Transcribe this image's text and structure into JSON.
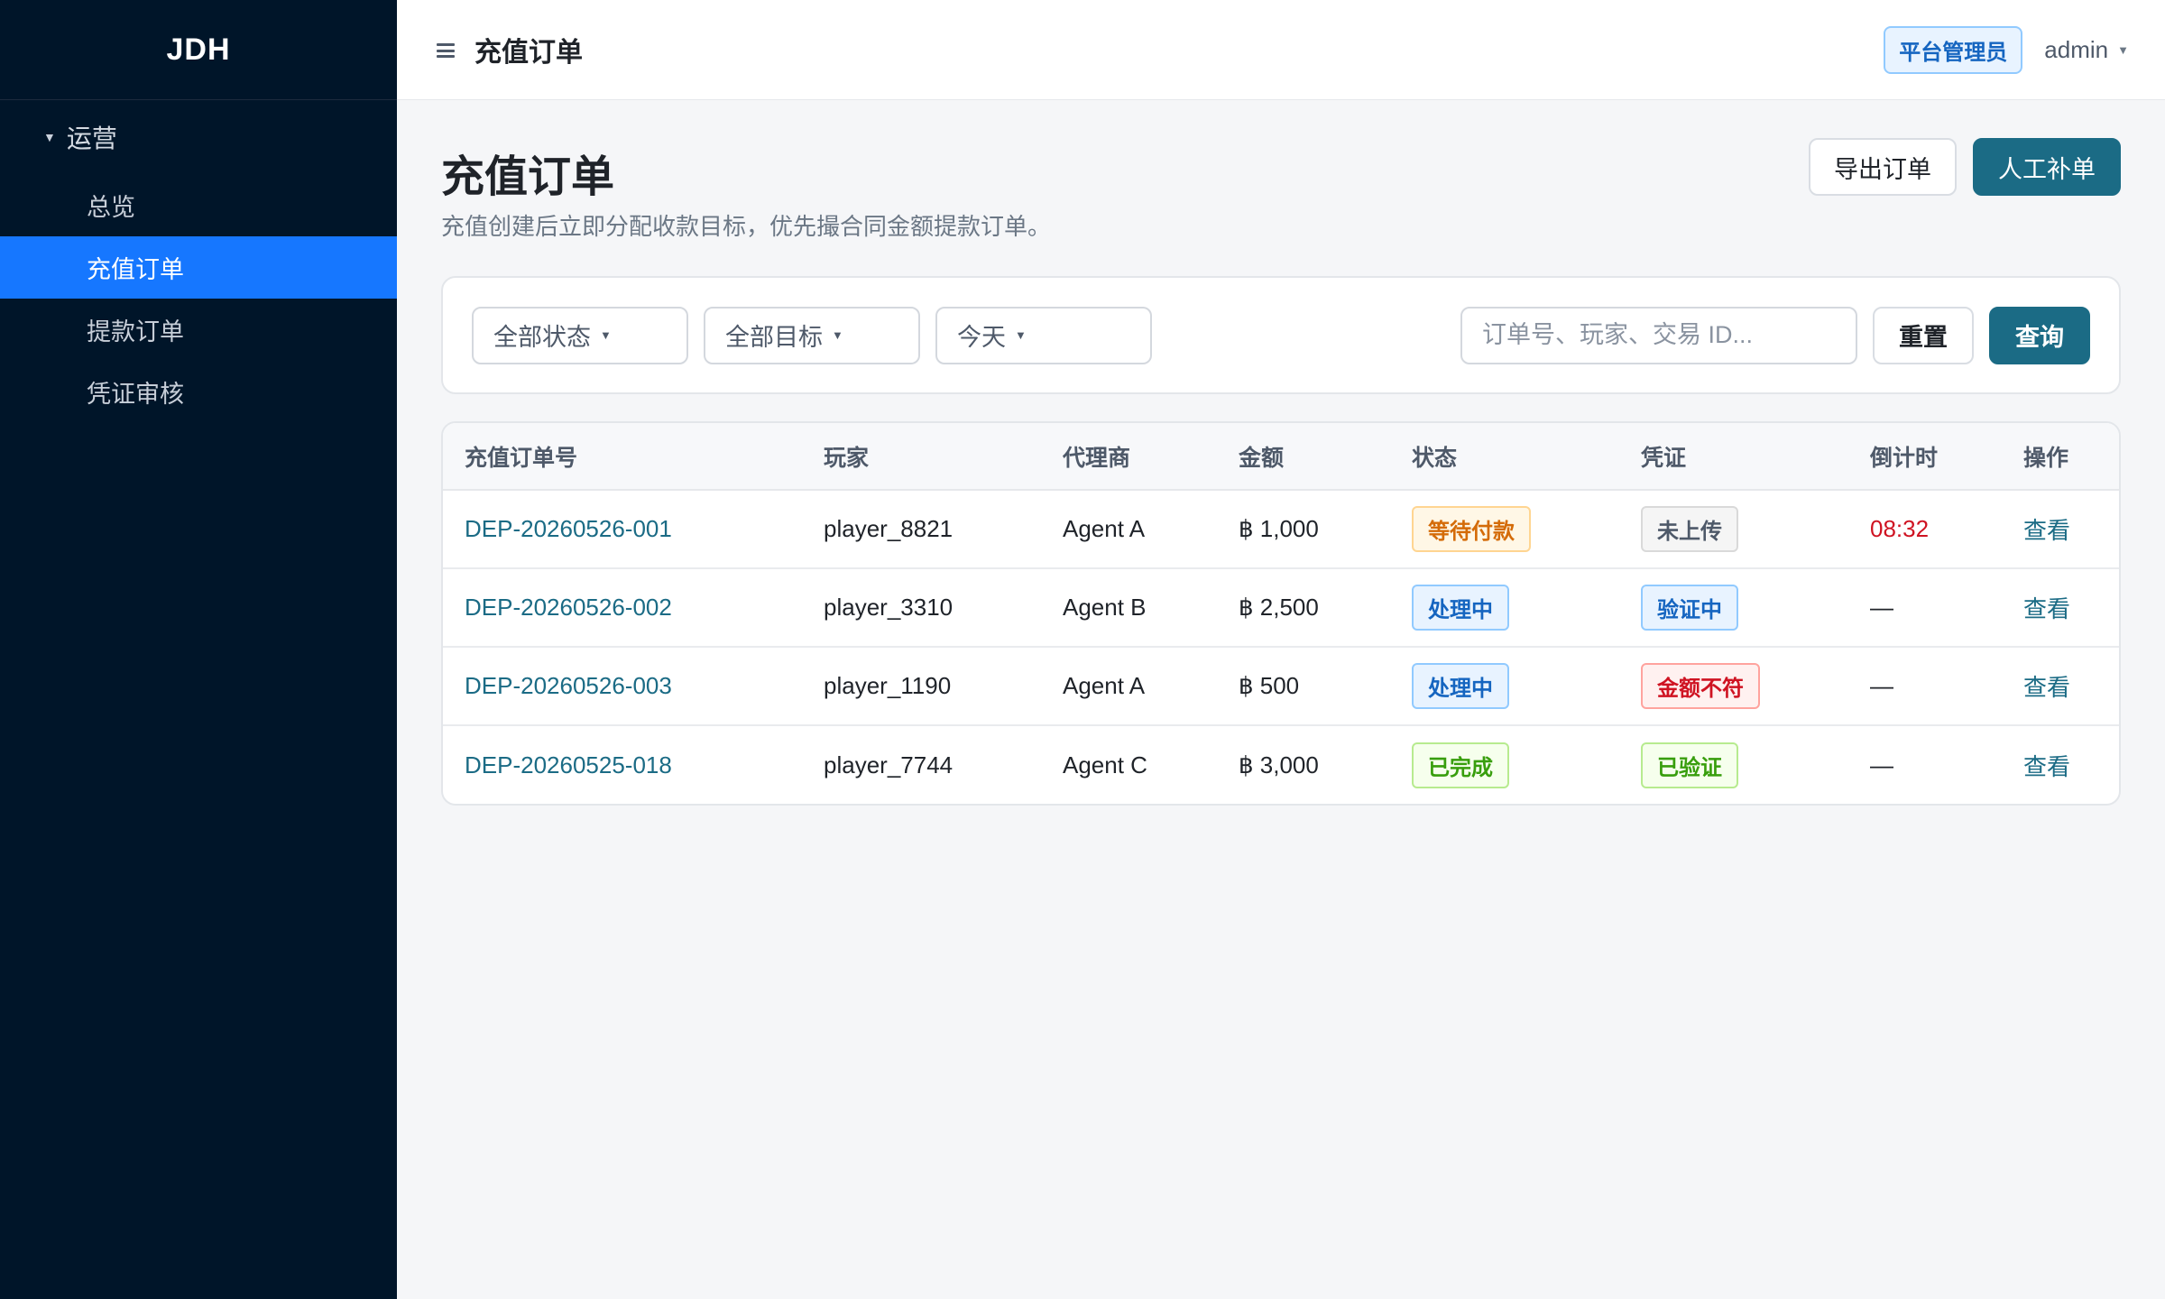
{
  "app": {
    "brand": "JDH"
  },
  "header": {
    "title": "充值订单",
    "role_badge": "平台管理员",
    "user": "admin"
  },
  "sidebar": {
    "group_label": "运营",
    "items": [
      {
        "label": "总览",
        "active": false
      },
      {
        "label": "充值订单",
        "active": true
      },
      {
        "label": "提款订单",
        "active": false
      },
      {
        "label": "凭证审核",
        "active": false
      }
    ]
  },
  "page": {
    "title": "充值订单",
    "description": "充值创建后立即分配收款目标，优先撮合同金额提款订单。",
    "export_label": "导出订单",
    "manual_label": "人工补单"
  },
  "filters": {
    "status": "全部状态",
    "target": "全部目标",
    "date": "今天",
    "search_placeholder": "订单号、玩家、交易 ID...",
    "reset_label": "重置",
    "query_label": "查询"
  },
  "table": {
    "columns": [
      "充值订单号",
      "玩家",
      "代理商",
      "金额",
      "状态",
      "凭证",
      "倒计时",
      "操作"
    ],
    "rows": [
      {
        "order_id": "DEP-20260526-001",
        "player": "player_8821",
        "agent": "Agent A",
        "amount": "฿ 1,000",
        "status": "等待付款",
        "status_color": "orange",
        "proof": "未上传",
        "proof_color": "gray",
        "countdown": "08:32",
        "action": "查看"
      },
      {
        "order_id": "DEP-20260526-002",
        "player": "player_3310",
        "agent": "Agent B",
        "amount": "฿ 2,500",
        "status": "处理中",
        "status_color": "blue",
        "proof": "验证中",
        "proof_color": "blue",
        "countdown": "—",
        "action": "查看"
      },
      {
        "order_id": "DEP-20260526-003",
        "player": "player_1190",
        "agent": "Agent A",
        "amount": "฿ 500",
        "status": "处理中",
        "status_color": "blue",
        "proof": "金额不符",
        "proof_color": "red",
        "countdown": "—",
        "action": "查看"
      },
      {
        "order_id": "DEP-20260525-018",
        "player": "player_7744",
        "agent": "Agent C",
        "amount": "฿ 3,000",
        "status": "已完成",
        "status_color": "green",
        "proof": "已验证",
        "proof_color": "green",
        "countdown": "—",
        "action": "查看"
      }
    ]
  },
  "colors": {
    "sidebar_bg": "#001529",
    "active_item": "#1677ff",
    "primary": "#1b6b85",
    "countdown_red": "#cf1322"
  }
}
